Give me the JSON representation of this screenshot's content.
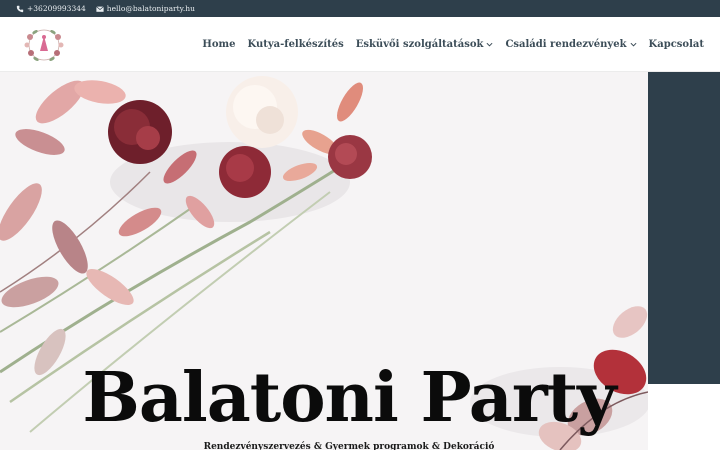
{
  "topbar": {
    "phone": "+36209993344",
    "email": "hello@balatoniparty.hu",
    "phone_icon": "phone-icon",
    "email_icon": "envelope-icon"
  },
  "header": {
    "logo": "floral-wreath-logo",
    "nav": [
      {
        "label": "Home",
        "has_dropdown": false
      },
      {
        "label": "Kutya-felkészítés",
        "has_dropdown": false
      },
      {
        "label": "Esküvői szolgáltatások",
        "has_dropdown": true
      },
      {
        "label": "Családi rendezvények",
        "has_dropdown": true
      },
      {
        "label": "Kapcsolat",
        "has_dropdown": false
      }
    ]
  },
  "hero": {
    "title": "Balatoni Party",
    "subtitle": "Rendezvényszervezés & Gyermek programok & Dekoráció"
  },
  "colors": {
    "topbar_bg": "#2e3f4b",
    "nav_text": "#3c4d58",
    "accent_panel": "#2e3f4b",
    "title_text": "#0b0b0b"
  }
}
